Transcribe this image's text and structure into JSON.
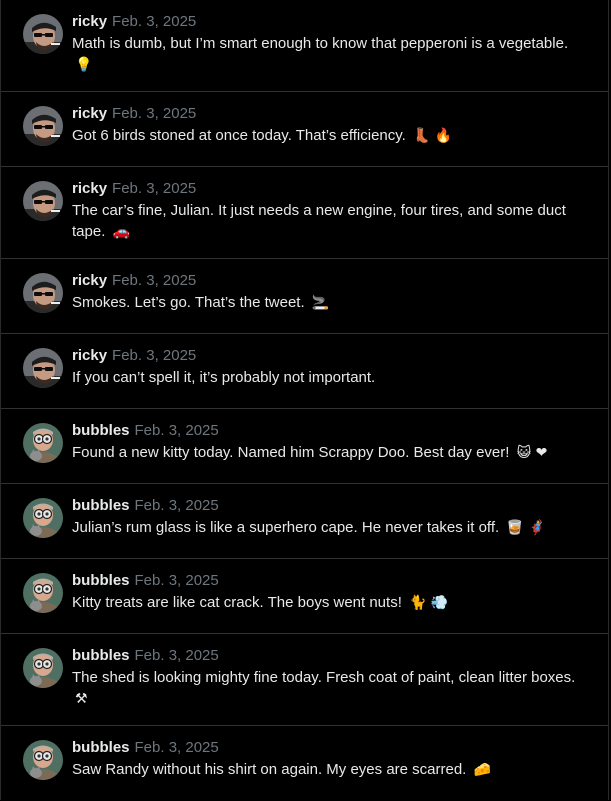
{
  "posts": [
    {
      "user": "ricky",
      "date": "Feb. 3, 2025",
      "text": "Math is dumb, but I’m smart enough to know that pepperoni is a vegetable.",
      "emoji": "💡",
      "avatar_icon": "ricky-avatar"
    },
    {
      "user": "ricky",
      "date": "Feb. 3, 2025",
      "text": "Got 6 birds stoned at once today. That’s efficiency.",
      "emoji": "👢 🔥",
      "avatar_icon": "ricky-avatar"
    },
    {
      "user": "ricky",
      "date": "Feb. 3, 2025",
      "text": "The car’s fine, Julian. It just needs a new engine, four tires, and some duct tape.",
      "emoji": "🚗",
      "avatar_icon": "ricky-avatar"
    },
    {
      "user": "ricky",
      "date": "Feb. 3, 2025",
      "text": "Smokes. Let’s go. That’s the tweet.",
      "emoji": "🚬",
      "avatar_icon": "ricky-avatar"
    },
    {
      "user": "ricky",
      "date": "Feb. 3, 2025",
      "text": "If you can’t spell it, it’s probably not important.",
      "emoji": "",
      "avatar_icon": "ricky-avatar"
    },
    {
      "user": "bubbles",
      "date": "Feb. 3, 2025",
      "text": "Found a new kitty today. Named him Scrappy Doo. Best day ever!",
      "emoji": "😺 ❤",
      "avatar_icon": "bubbles-avatar"
    },
    {
      "user": "bubbles",
      "date": "Feb. 3, 2025",
      "text": "Julian’s rum glass is like a superhero cape. He never takes it off.",
      "emoji": "🥃 🦸",
      "avatar_icon": "bubbles-avatar"
    },
    {
      "user": "bubbles",
      "date": "Feb. 3, 2025",
      "text": "Kitty treats are like cat crack. The boys went nuts!",
      "emoji": "🐈 💨",
      "avatar_icon": "bubbles-avatar"
    },
    {
      "user": "bubbles",
      "date": "Feb. 3, 2025",
      "text": "The shed is looking mighty fine today. Fresh coat of paint, clean litter boxes.",
      "emoji": "⚒",
      "avatar_icon": "bubbles-avatar"
    },
    {
      "user": "bubbles",
      "date": "Feb. 3, 2025",
      "text": "Saw Randy without his shirt on again. My eyes are scarred.",
      "emoji": "🧀",
      "avatar_icon": "bubbles-avatar"
    }
  ],
  "colors": {
    "background": "#000000",
    "text": "#e7e9ea",
    "muted": "#6e767d",
    "divider": "#2f3336"
  }
}
